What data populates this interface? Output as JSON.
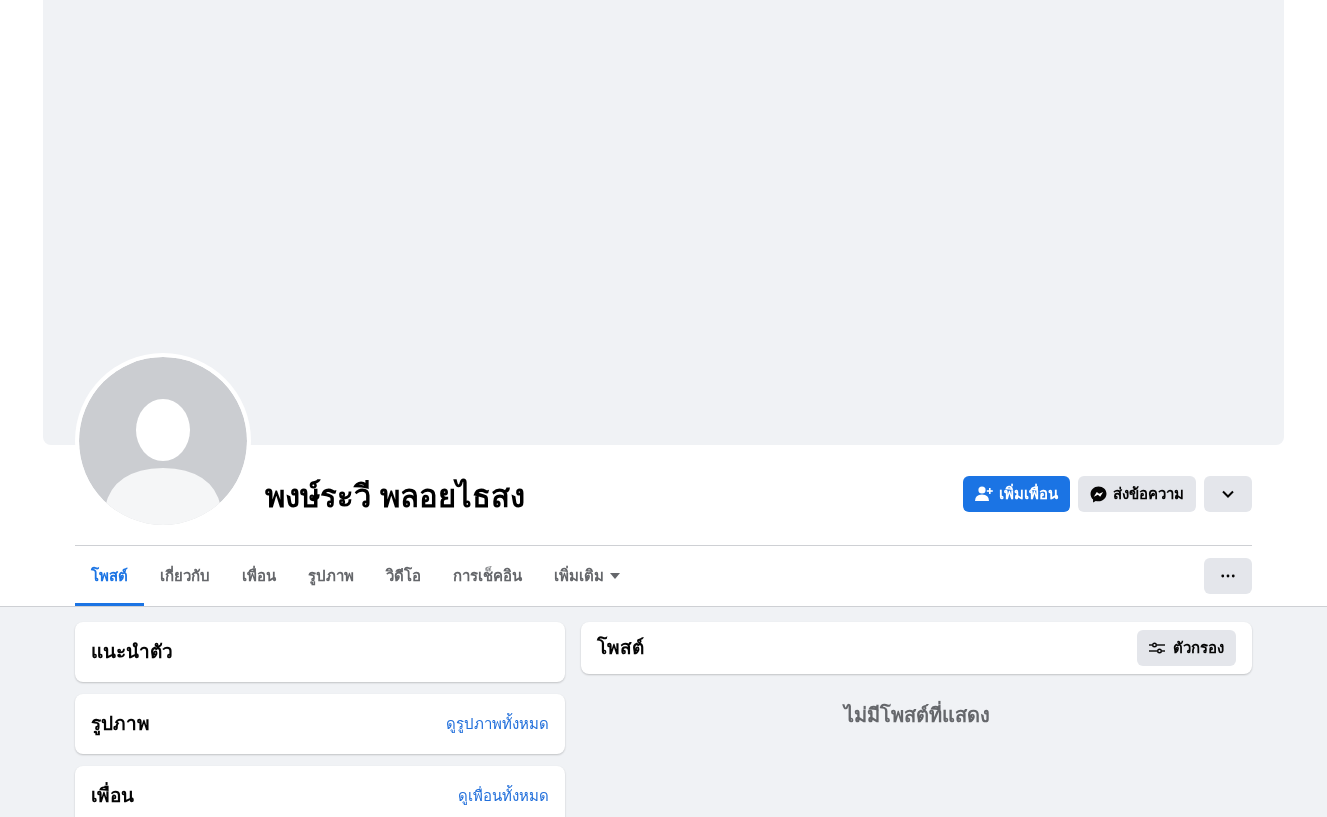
{
  "profile": {
    "name": "พงษ์ระวี พลอยไธสง"
  },
  "actions": [
    {
      "kind": "primary",
      "label": "เพิ่มเพื่อน"
    },
    {
      "kind": "secondary",
      "label": "ส่งข้อความ"
    },
    {
      "kind": "icon"
    }
  ],
  "tabs": [
    {
      "label": "โพสต์",
      "selected": true
    },
    {
      "label": "เกี่ยวกับ",
      "selected": false
    },
    {
      "label": "เพื่อน",
      "selected": false
    },
    {
      "label": "รูปภาพ",
      "selected": false
    },
    {
      "label": "วิดีโอ",
      "selected": false
    },
    {
      "label": "การเช็คอิน",
      "selected": false
    },
    {
      "label": "เพิ่มเติม",
      "selected": false,
      "dropdown": true
    }
  ],
  "left_cards": [
    {
      "title": "แนะนำตัว"
    },
    {
      "title": "รูปภาพ",
      "link": "ดูรูปภาพทั้งหมด"
    },
    {
      "title": "เพื่อน",
      "link": "ดูเพื่อนทั้งหมด"
    }
  ],
  "posts": {
    "title": "โพสต์",
    "filter_button": "ตัวกรอง",
    "empty_message": "ไม่มีโพสต์ที่แสดง"
  }
}
